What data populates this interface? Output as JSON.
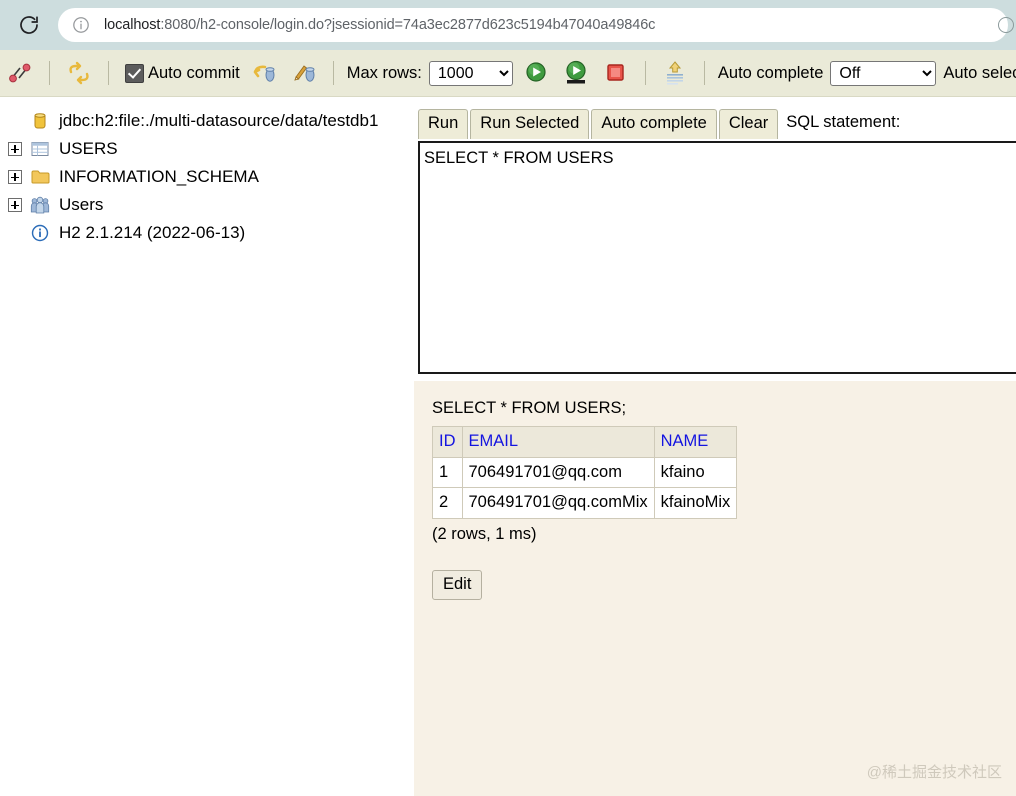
{
  "browser": {
    "reload_icon": "reload-icon",
    "info_icon": "site-info-icon",
    "url_host": "localhost",
    "url_rest": ":8080/h2-console/login.do?jsessionid=74a3ec2877d623c5194b47040a49846c",
    "url_full": "localhost:8080/h2-console/login.do?jsessionid=74a3ec2877d623c5194b47040a49846c"
  },
  "toolbar": {
    "disconnect_icon": "disconnect-icon",
    "refresh_icon": "refresh-icon",
    "auto_commit_label": "Auto commit",
    "auto_commit_checked": true,
    "rollback_icon": "rollback-icon",
    "commit_icon": "commit-icon",
    "max_rows_label": "Max rows:",
    "max_rows_value": "1000",
    "max_rows_options": [
      "1000"
    ],
    "run_icon": "run-play-icon",
    "run_selected_icon": "run-selected-play-icon",
    "stop_icon": "stop-icon",
    "autocomplete_icon": "auto-complete-icon",
    "auto_complete_label": "Auto complete",
    "auto_complete_value": "Off",
    "auto_complete_options": [
      "Off"
    ],
    "auto_select_label": "Auto select"
  },
  "tree": {
    "items": [
      {
        "label": "jdbc:h2:file:./multi-datasource/data/testdb1",
        "icon": "database-icon",
        "expandable": false
      },
      {
        "label": "USERS",
        "icon": "table-icon",
        "expandable": true
      },
      {
        "label": "INFORMATION_SCHEMA",
        "icon": "folder-icon",
        "expandable": true
      },
      {
        "label": "Users",
        "icon": "users-icon",
        "expandable": true
      },
      {
        "label": "H2 2.1.214 (2022-06-13)",
        "icon": "info-icon",
        "expandable": false
      }
    ]
  },
  "sql": {
    "buttons": [
      "Run",
      "Run Selected",
      "Auto complete",
      "Clear"
    ],
    "statement_label": "SQL statement:",
    "statement_value": "SELECT * FROM USERS"
  },
  "result": {
    "query": "SELECT * FROM USERS;",
    "columns": [
      "ID",
      "EMAIL",
      "NAME"
    ],
    "rows": [
      [
        "1",
        "706491701@qq.com",
        "kfaino"
      ],
      [
        "2",
        "706491701@qq.comMix",
        "kfainoMix"
      ]
    ],
    "stats": "(2 rows, 1 ms)",
    "edit_label": "Edit"
  },
  "watermark": {
    "text": "@稀土掘金技术社区"
  },
  "colors": {
    "chrome_bg": "#cdddde",
    "toolbar_bg": "#eaead8",
    "result_bg": "#f7f1e6",
    "header_text": "#1414e0",
    "button_bg": "#eeecd8"
  }
}
